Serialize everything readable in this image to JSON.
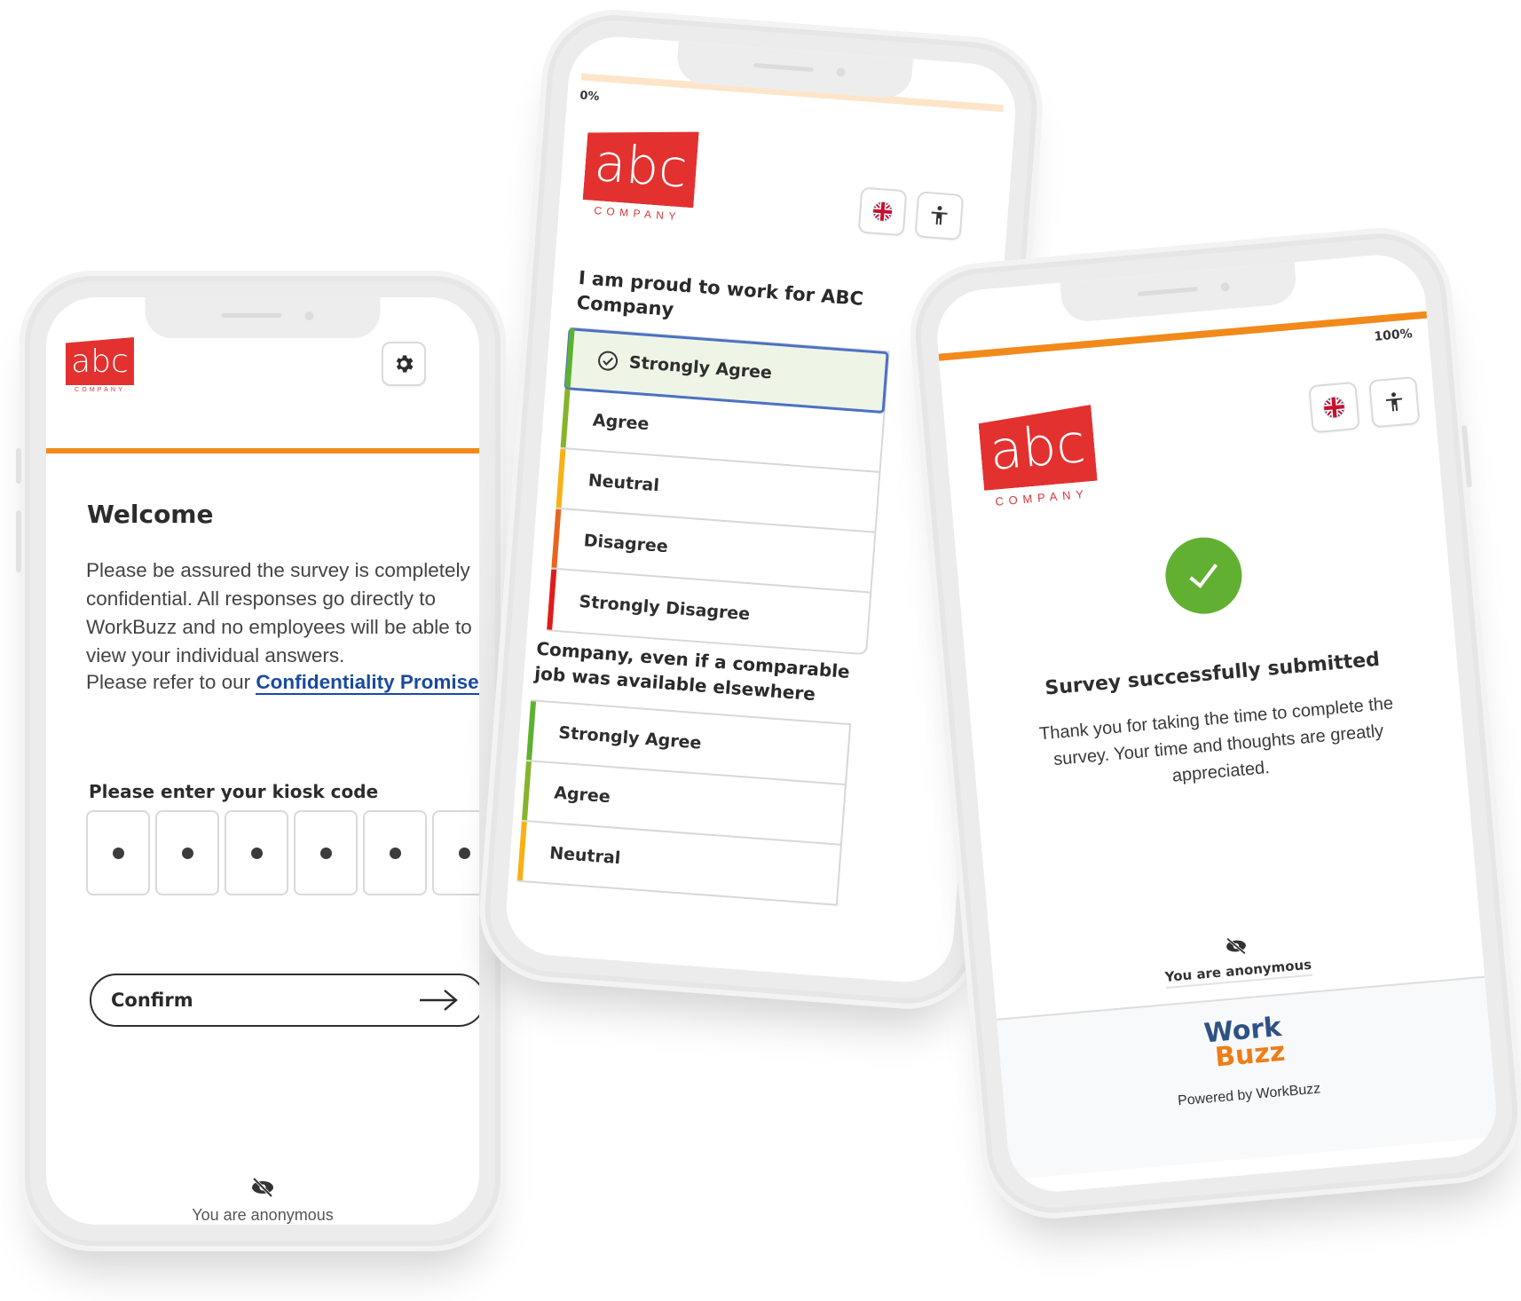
{
  "brand": {
    "logo_text": "abc",
    "logo_subtitle": "COMPANY",
    "accent_color": "#f18a1b",
    "logo_color": "#e3312f"
  },
  "welcome_screen": {
    "title": "Welcome",
    "paragraph": "Please be assured the survey is completely confidential. All responses go directly to WorkBuzz and no employees will be able to view your individual answers.",
    "refer_prefix": "Please refer to our ",
    "refer_link": "Confidentiality Promise",
    "refer_suffix": ".",
    "kiosk_label": "Please enter your kiosk code",
    "kiosk_code_length": 6,
    "confirm_label": "Confirm",
    "anonymous_label": "You are anonymous",
    "settings_icon": "gear-icon"
  },
  "question_screen": {
    "progress_label": "0%",
    "progress": 0,
    "language_icon": "uk-flag-icon",
    "accessibility_icon": "accessibility-icon",
    "question1": "I am proud to work for ABC Company",
    "question1_options": [
      {
        "label": "Strongly Agree",
        "color": "#5db130",
        "selected": true
      },
      {
        "label": "Agree",
        "color": "#86b42a",
        "selected": false
      },
      {
        "label": "Neutral",
        "color": "#f7b016",
        "selected": false
      },
      {
        "label": "Disagree",
        "color": "#e8651f",
        "selected": false
      },
      {
        "label": "Strongly Disagree",
        "color": "#e01b1b",
        "selected": false
      }
    ],
    "question2_partial": "Company, even if a comparable job was available elsewhere",
    "question2_options": [
      {
        "label": "Strongly Agree",
        "color": "#5db130"
      },
      {
        "label": "Agree",
        "color": "#86b42a"
      },
      {
        "label": "Neutral",
        "color": "#f7b016"
      }
    ]
  },
  "submitted_screen": {
    "progress_label": "100%",
    "progress": 100,
    "title": "Survey successfully submitted",
    "body": "Thank you for taking the time to complete the survey. Your time and thoughts are greatly appreciated.",
    "anonymous_label": "You are anonymous",
    "footer_logo_line1": "Work",
    "footer_logo_line2": "Buzz",
    "powered_by": "Powered by WorkBuzz"
  }
}
